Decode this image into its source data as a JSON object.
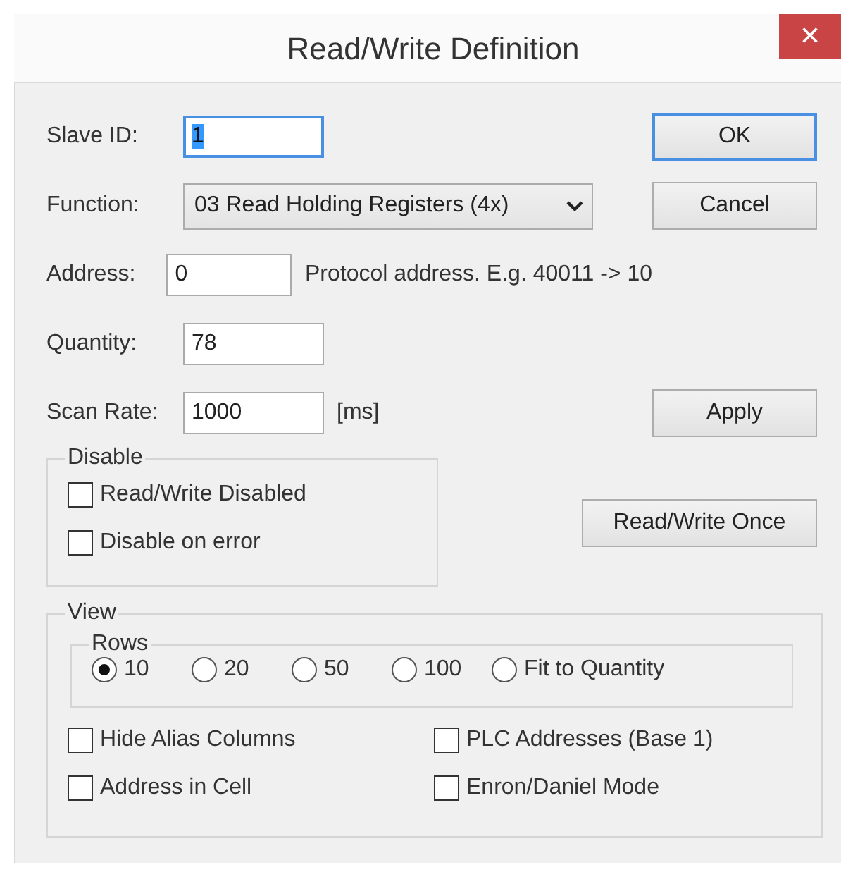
{
  "window": {
    "title": "Read/Write Definition",
    "close": "×"
  },
  "fields": [
    {
      "label": "Slave ID:",
      "value": "1",
      "kind": "text",
      "focused": true
    },
    {
      "label": "Function:",
      "value": "03 Read Holding Registers (4x)",
      "kind": "combo",
      "focused": false
    },
    {
      "label": "Address:",
      "value": "0",
      "kind": "text",
      "focused": false,
      "note": "Protocol address. E.g. 40011 -> 10"
    },
    {
      "label": "Quantity:",
      "value": "78",
      "kind": "text",
      "focused": false
    },
    {
      "label": "Scan Rate:",
      "value": "1000",
      "kind": "text",
      "focused": false,
      "note": "[ms]"
    }
  ],
  "buttons": [
    {
      "label": "OK",
      "default": true
    },
    {
      "label": "Cancel",
      "default": false
    },
    {
      "label": "Apply",
      "default": false
    },
    {
      "label": "Read/Write Once",
      "default": false
    }
  ],
  "disable": {
    "title": "Disable",
    "options": [
      {
        "label": "Read/Write Disabled",
        "checked": false
      },
      {
        "label": "Disable on error",
        "checked": false
      }
    ]
  },
  "view": {
    "title": "View",
    "rows": {
      "title": "Rows",
      "options": [
        {
          "label": "10",
          "selected": true
        },
        {
          "label": "20",
          "selected": false
        },
        {
          "label": "50",
          "selected": false
        },
        {
          "label": "100",
          "selected": false
        },
        {
          "label": "Fit to Quantity",
          "selected": false
        }
      ]
    },
    "options": [
      {
        "label": "Hide Alias Columns",
        "checked": false
      },
      {
        "label": "PLC Addresses (Base 1)",
        "checked": false
      },
      {
        "label": "Address in Cell",
        "checked": false
      },
      {
        "label": "Enron/Daniel Mode",
        "checked": false
      }
    ]
  }
}
